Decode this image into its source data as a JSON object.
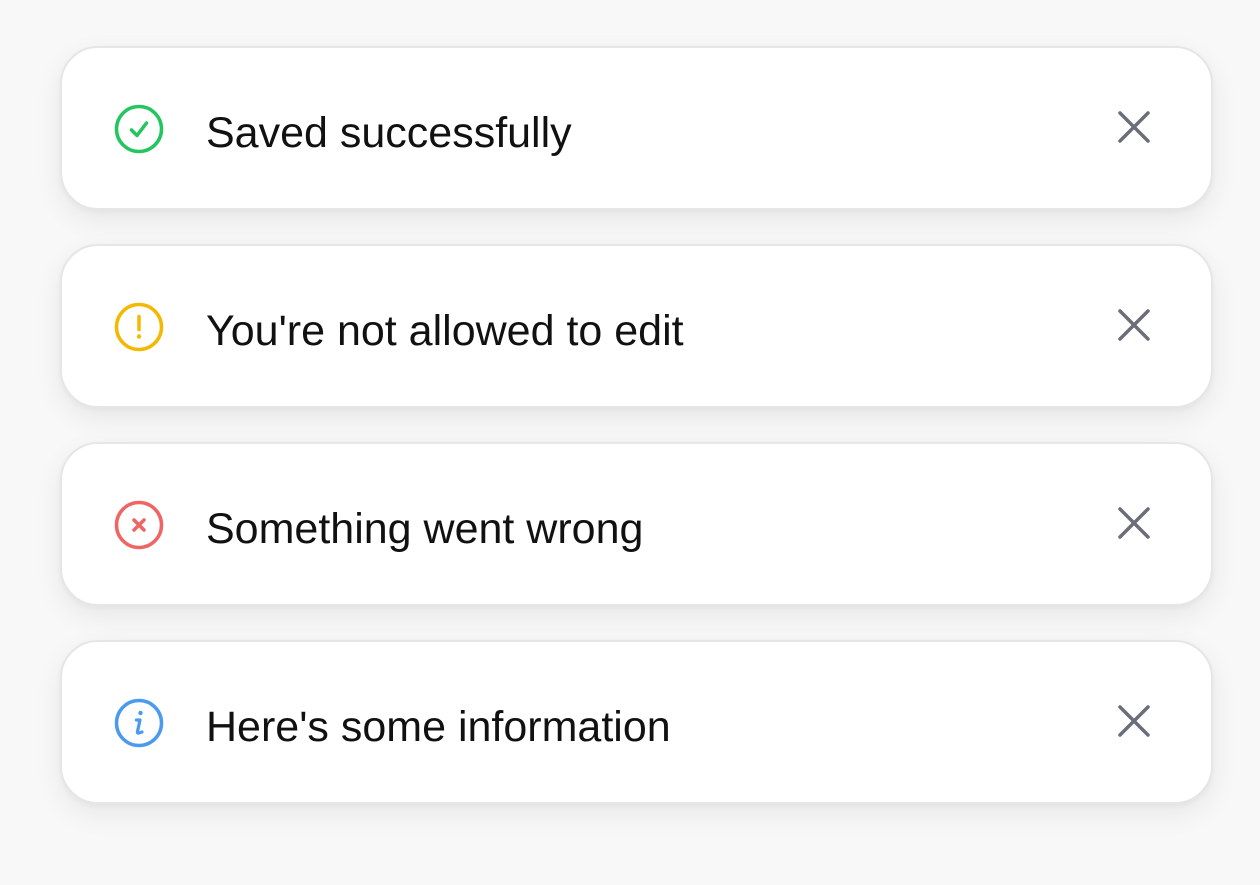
{
  "colors": {
    "success": "#22c55e",
    "warning": "#f5b800",
    "error": "#f06464",
    "info": "#4a9af0",
    "close": "#6b6e78",
    "text": "#111111"
  },
  "toasts": [
    {
      "type": "success",
      "icon": "check-circle-icon",
      "message": "Saved successfully",
      "close_icon": "close-icon"
    },
    {
      "type": "warning",
      "icon": "exclamation-circle-icon",
      "message": "You're not allowed to edit",
      "close_icon": "close-icon"
    },
    {
      "type": "error",
      "icon": "x-circle-icon",
      "message": "Something went wrong",
      "close_icon": "close-icon"
    },
    {
      "type": "info",
      "icon": "info-circle-icon",
      "message": "Here's some information",
      "close_icon": "close-icon"
    }
  ]
}
